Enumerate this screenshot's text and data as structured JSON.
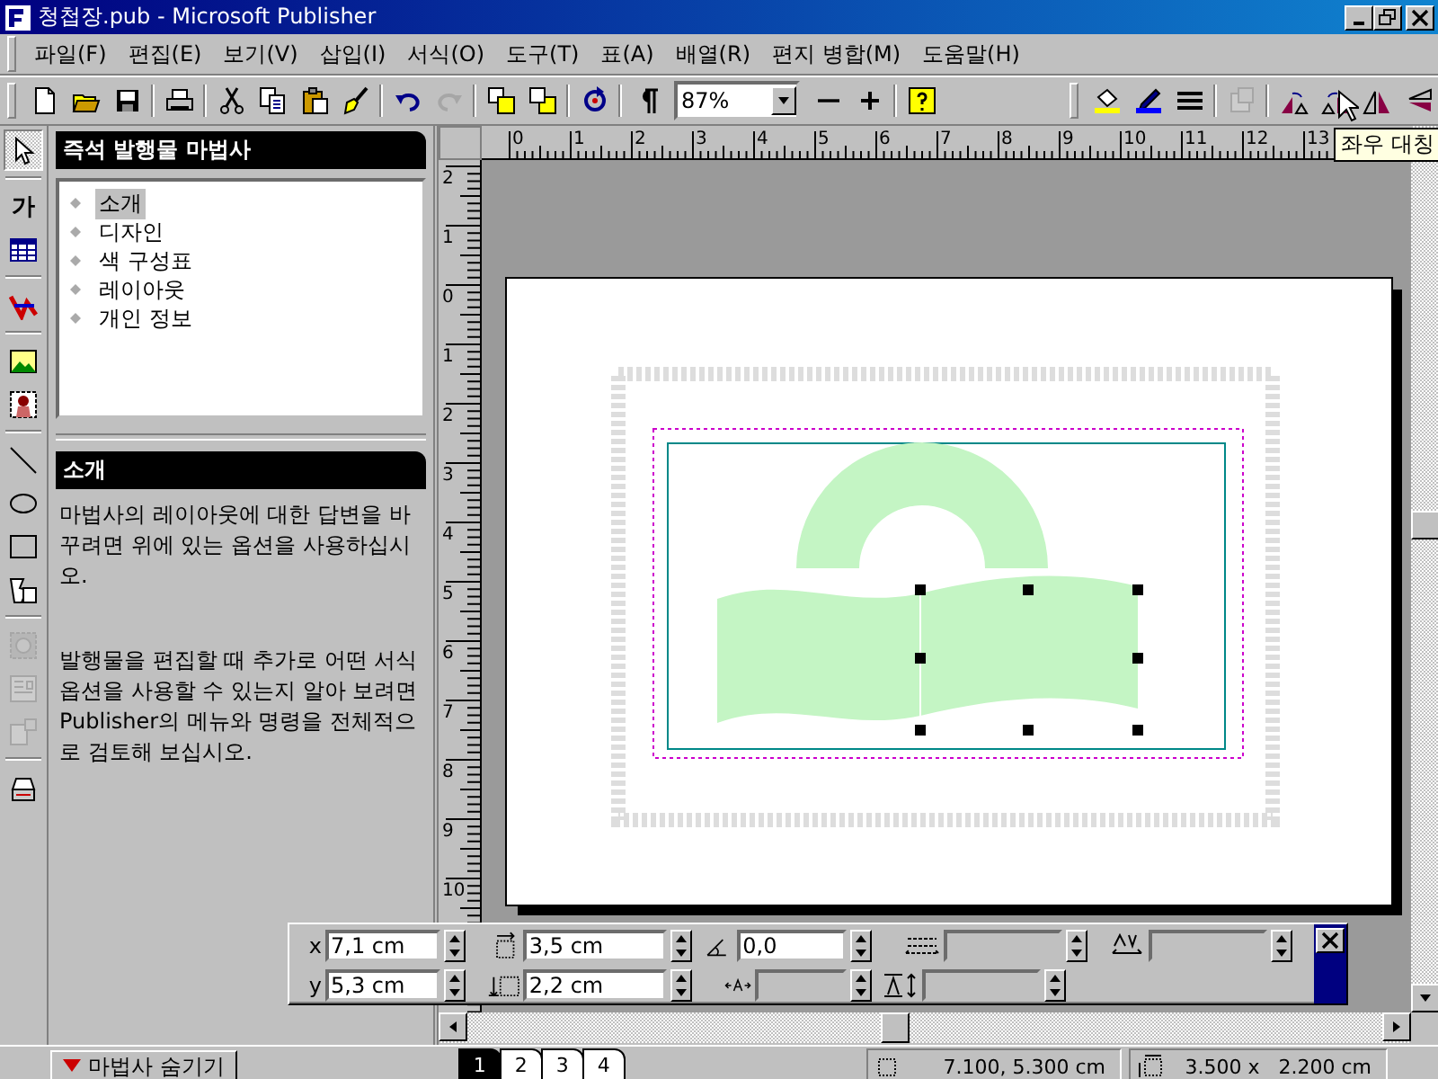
{
  "window": {
    "title": "청첩장.pub - Microsoft Publisher"
  },
  "menu": [
    "파일(F)",
    "편집(E)",
    "보기(V)",
    "삽입(I)",
    "서식(O)",
    "도구(T)",
    "표(A)",
    "배열(R)",
    "편지 병합(M)",
    "도움말(H)"
  ],
  "toolbar": {
    "groups": [
      [
        {
          "kind": "new",
          "disabled": false
        },
        {
          "kind": "open",
          "disabled": false
        },
        {
          "kind": "save",
          "disabled": false
        }
      ],
      [
        {
          "kind": "print",
          "disabled": false
        }
      ],
      [
        {
          "kind": "cut",
          "disabled": false
        },
        {
          "kind": "copy",
          "disabled": false
        },
        {
          "kind": "paste",
          "disabled": false
        },
        {
          "kind": "painter",
          "disabled": false
        }
      ],
      [
        {
          "kind": "undo",
          "disabled": false
        },
        {
          "kind": "redo",
          "disabled": true
        }
      ],
      [
        {
          "kind": "front",
          "disabled": false
        },
        {
          "kind": "back",
          "disabled": false
        }
      ],
      [
        {
          "kind": "rotate",
          "disabled": false
        }
      ],
      [
        {
          "kind": "pilcrow",
          "disabled": false
        },
        {
          "kind": "zoom",
          "value": "87%",
          "disabled": false
        },
        {
          "kind": "minus",
          "disabled": false
        },
        {
          "kind": "plus",
          "disabled": false
        }
      ],
      [
        {
          "kind": "help",
          "disabled": false
        }
      ]
    ],
    "right_groups": [
      [
        {
          "kind": "fill",
          "disabled": false
        },
        {
          "kind": "linecolor",
          "disabled": false
        },
        {
          "kind": "linestyle",
          "disabled": false
        }
      ],
      [
        {
          "kind": "properties",
          "disabled": true
        }
      ],
      [
        {
          "kind": "rotl",
          "disabled": false
        },
        {
          "kind": "rotr",
          "disabled": false
        },
        {
          "kind": "fliph",
          "disabled": false
        },
        {
          "kind": "flipv",
          "disabled": false
        }
      ]
    ]
  },
  "tooltip": "좌우 대칭",
  "tools": [
    [
      {
        "kind": "pointer",
        "selected": true,
        "disabled": false
      }
    ],
    [
      {
        "kind": "text",
        "label": "가",
        "selected": false,
        "disabled": false
      },
      {
        "kind": "table",
        "selected": false,
        "disabled": false
      }
    ],
    [
      {
        "kind": "wordart",
        "selected": false,
        "disabled": false
      }
    ],
    [
      {
        "kind": "picture",
        "selected": false,
        "disabled": false
      },
      {
        "kind": "clipart",
        "selected": false,
        "disabled": false
      }
    ],
    [
      {
        "kind": "line",
        "selected": false,
        "disabled": false
      },
      {
        "kind": "oval",
        "selected": false,
        "disabled": false
      },
      {
        "kind": "rect",
        "selected": false,
        "disabled": false
      },
      {
        "kind": "shape",
        "selected": false,
        "disabled": false
      }
    ],
    [
      {
        "kind": "control",
        "selected": false,
        "disabled": true
      },
      {
        "kind": "html",
        "selected": false,
        "disabled": true
      },
      {
        "kind": "object",
        "selected": false,
        "disabled": true
      }
    ],
    [
      {
        "kind": "gallery",
        "selected": false,
        "disabled": false
      }
    ]
  ],
  "wizard": {
    "title": "즉석 발행물 마법사",
    "items": [
      {
        "label": "소개",
        "selected": true
      },
      {
        "label": "디자인",
        "selected": false
      },
      {
        "label": "색 구성표",
        "selected": false
      },
      {
        "label": "레이아웃",
        "selected": false
      },
      {
        "label": "개인 정보",
        "selected": false
      }
    ],
    "section_title": "소개",
    "paragraphs": [
      "마법사의 레이아웃에 대한 답변을 바꾸려면 위에 있는 옵션을 사용하십시오.",
      "발행물을 편집할 때 추가로 어떤 서식 옵션을 사용할 수 있는지 알아 보려면 Publisher의 메뉴와 명령을 전체적으로 검토해 보십시오."
    ]
  },
  "rulers": {
    "horizontal": [
      "0",
      "1",
      "2",
      "3",
      "4",
      "5",
      "6",
      "7",
      "8",
      "9",
      "10",
      "11",
      "12",
      "13"
    ],
    "vertical": [
      "2",
      "1",
      "0",
      "1",
      "2",
      "3",
      "4",
      "5",
      "6",
      "7",
      "8",
      "9",
      "10"
    ]
  },
  "measure": {
    "fields": [
      {
        "kind": "x",
        "label": "x",
        "value": "7,1 cm",
        "disabled": false
      },
      {
        "kind": "width",
        "value": "3,5 cm",
        "disabled": false
      },
      {
        "kind": "angle",
        "value": "0,0",
        "disabled": false
      },
      {
        "kind": "spacing",
        "disabled": true
      },
      {
        "kind": "kerning",
        "disabled": true
      },
      {
        "kind": "y",
        "label": "y",
        "value": "5,3 cm",
        "disabled": false
      },
      {
        "kind": "height",
        "value": "2,2 cm",
        "disabled": false
      },
      {
        "kind": "scaling",
        "disabled": true
      },
      {
        "kind": "linespacing",
        "disabled": true
      }
    ]
  },
  "status": {
    "wizard_button": "마법사 숨기기",
    "pages": [
      {
        "label": "1",
        "selected": true
      },
      {
        "label": "2",
        "selected": false
      },
      {
        "label": "3",
        "selected": false
      },
      {
        "label": "4",
        "selected": false
      }
    ],
    "position": "7.100, 5.300 cm",
    "size": "3.500 x   2.200 cm"
  }
}
